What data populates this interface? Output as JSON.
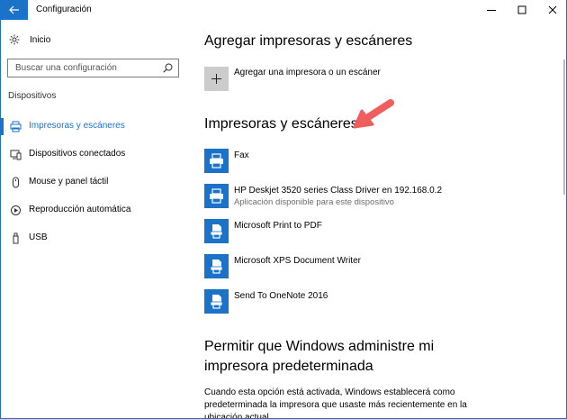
{
  "window": {
    "title": "Configuración",
    "accent_color": "#1a73c9"
  },
  "sidebar": {
    "home_label": "Inicio",
    "search": {
      "placeholder": "Buscar una configuración"
    },
    "section_label": "Dispositivos",
    "items": [
      {
        "label": "Impresoras y escáneres",
        "icon": "printer-icon",
        "active": true
      },
      {
        "label": "Dispositivos conectados",
        "icon": "devices-icon",
        "active": false
      },
      {
        "label": "Mouse y panel táctil",
        "icon": "mouse-icon",
        "active": false
      },
      {
        "label": "Reproducción automática",
        "icon": "autoplay-icon",
        "active": false
      },
      {
        "label": "USB",
        "icon": "usb-icon",
        "active": false
      }
    ]
  },
  "main": {
    "add_heading": "Agregar impresoras y escáneres",
    "add_button_label": "Agregar una impresora o un escáner",
    "printers_heading": "Impresoras y escáneres",
    "devices": [
      {
        "name": "Fax",
        "subtitle": "",
        "icon": "fax-icon"
      },
      {
        "name": "HP Deskjet 3520 series Class Driver en 192.168.0.2",
        "subtitle": "Aplicación disponible para este dispositivo",
        "icon": "printer-icon"
      },
      {
        "name": "Microsoft Print to PDF",
        "subtitle": "",
        "icon": "document-printer-icon"
      },
      {
        "name": "Microsoft XPS Document Writer",
        "subtitle": "",
        "icon": "document-printer-icon"
      },
      {
        "name": "Send To OneNote 2016",
        "subtitle": "",
        "icon": "document-printer-icon"
      }
    ],
    "default_heading": "Permitir que Windows administre mi impresora predeterminada",
    "default_description": "Cuando esta opción está activada, Windows establecerá como predeterminada la impresora que usaste más recientemente en la ubicación actual."
  }
}
